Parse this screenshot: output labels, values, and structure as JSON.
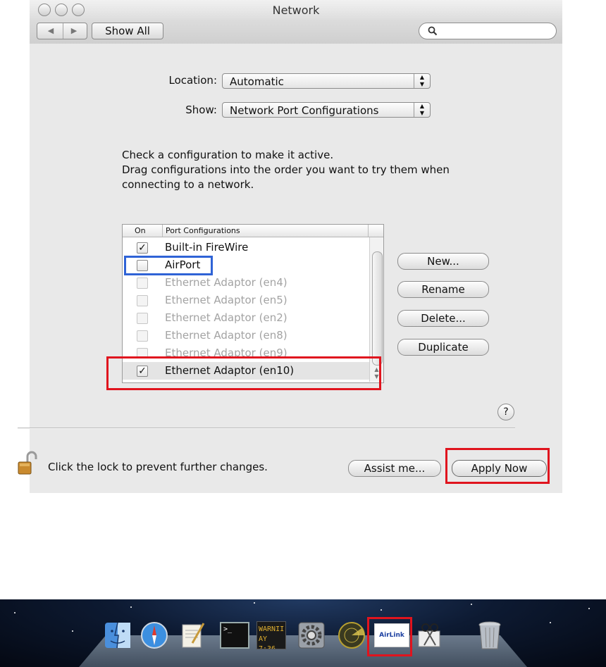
{
  "window": {
    "title": "Network",
    "nav_back": "◀",
    "nav_forward": "▶",
    "show_all": "Show All",
    "search_placeholder": ""
  },
  "form": {
    "location_label": "Location:",
    "location_value": "Automatic",
    "show_label": "Show:",
    "show_value": "Network Port Configurations"
  },
  "instructions": [
    "Check a configuration to make it active.",
    "Drag configurations into the order you want to try them when",
    "connecting to a network."
  ],
  "table": {
    "col_on": "On",
    "col_name": "Port Configurations",
    "rows": [
      {
        "label": "Built-in FireWire",
        "checked": "✓"
      },
      {
        "label": "AirPort",
        "checked": ""
      },
      {
        "label": "Ethernet Adaptor (en4)",
        "checked": ""
      },
      {
        "label": "Ethernet Adaptor (en5)",
        "checked": ""
      },
      {
        "label": "Ethernet Adaptor (en2)",
        "checked": ""
      },
      {
        "label": "Ethernet Adaptor (en8)",
        "checked": ""
      },
      {
        "label": "Ethernet Adaptor (en9)",
        "checked": ""
      },
      {
        "label": "Ethernet Adaptor (en10)",
        "checked": "✓"
      }
    ]
  },
  "buttons": {
    "new": "New...",
    "rename": "Rename",
    "delete": "Delete...",
    "duplicate": "Duplicate",
    "help": "?",
    "assist": "Assist me...",
    "apply": "Apply Now"
  },
  "lock_text": "Click the lock to prevent further changes.",
  "dock": {
    "terminal_prompt": ">_",
    "console_lines": [
      "WARNII",
      "AY 7:36"
    ],
    "airlink_text": "AirLink"
  },
  "colors": {
    "highlight_red": "#e0141e",
    "highlight_blue": "#2f63d6"
  }
}
